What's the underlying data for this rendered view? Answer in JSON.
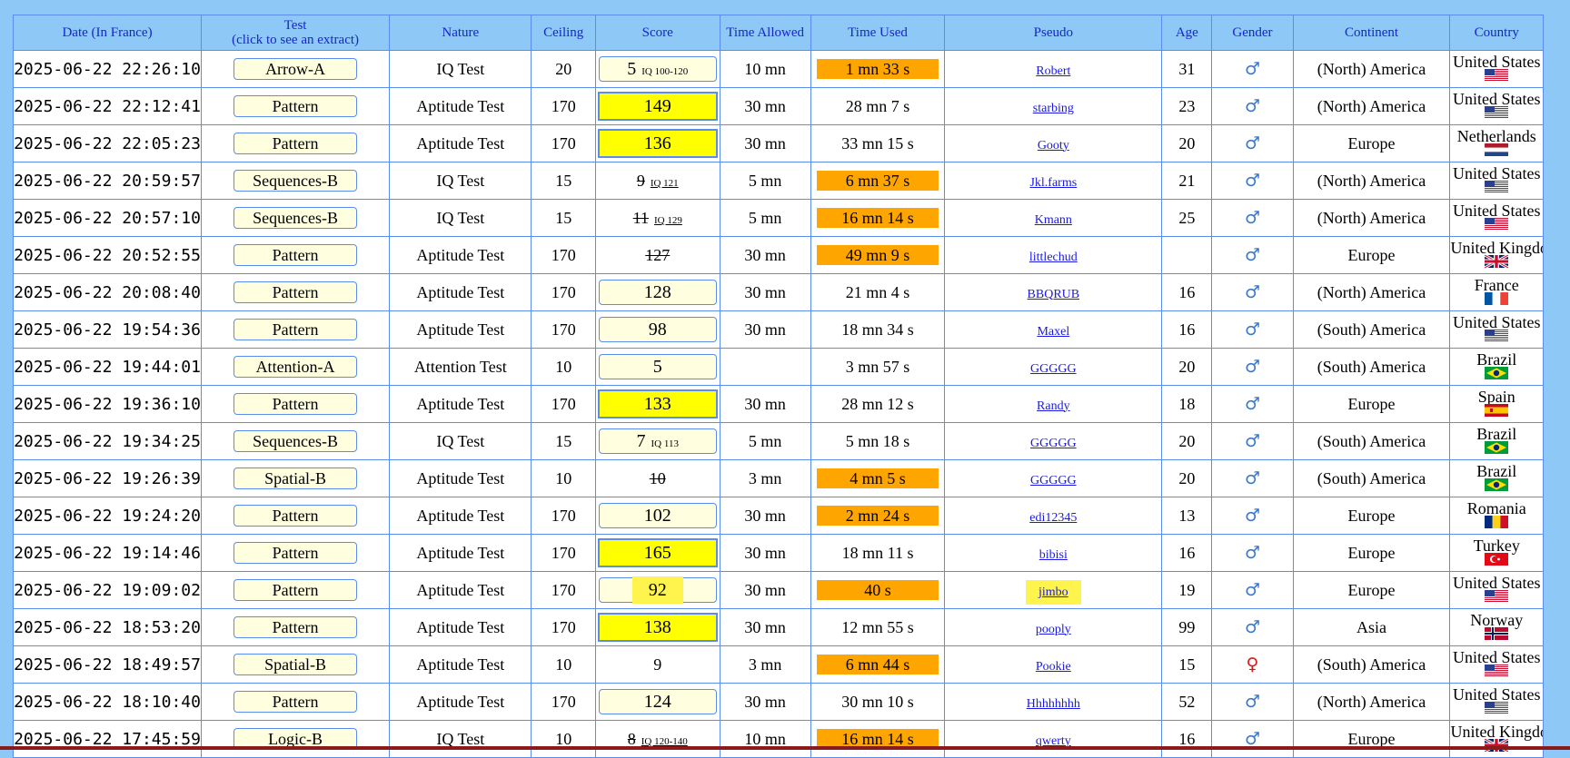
{
  "headers": {
    "date": "Date (In France)",
    "test": "Test",
    "test_sub": "(click to see an extract)",
    "nature": "Nature",
    "ceiling": "Ceiling",
    "score": "Score",
    "time_allowed": "Time Allowed",
    "time_used": "Time Used",
    "pseudo": "Pseudo",
    "age": "Age",
    "gender": "Gender",
    "continent": "Continent",
    "country": "Country"
  },
  "gender_symbols": {
    "male": "♂",
    "female": "♀"
  },
  "colors": {
    "header_bg": "#8ec8f6",
    "header_text": "#1626c9",
    "border": "#5b8def",
    "score_high": "#ffff00",
    "time_over": "#ffa500",
    "link": "#1a1ae6"
  },
  "rows": [
    {
      "date": "2025-06-22 22:26:10",
      "test": "Arrow-A",
      "nature": "IQ Test",
      "ceiling": "20",
      "score": "5",
      "iq": "IQ 100-120",
      "style": "box",
      "time_allowed": "10 mn",
      "time_used": "1 mn 33 s",
      "over": true,
      "pseudo": "Robert",
      "age": "31",
      "gender": "male",
      "continent": "(North) America",
      "country": "United States",
      "flag": "us"
    },
    {
      "date": "2025-06-22 22:12:41",
      "test": "Pattern",
      "nature": "Aptitude Test",
      "ceiling": "170",
      "score": "149",
      "iq": "",
      "style": "high",
      "time_allowed": "30 mn",
      "time_used": "28 mn 7 s",
      "over": false,
      "pseudo": "starbing",
      "age": "23",
      "gender": "male",
      "continent": "(North) America",
      "country": "United States",
      "flag": "us"
    },
    {
      "date": "2025-06-22 22:05:23",
      "test": "Pattern",
      "nature": "Aptitude Test",
      "ceiling": "170",
      "score": "136",
      "iq": "",
      "style": "high",
      "time_allowed": "30 mn",
      "time_used": "33 mn 15 s",
      "over": false,
      "pseudo": "Gooty",
      "age": "20",
      "gender": "male",
      "continent": "Europe",
      "country": "Netherlands",
      "flag": "nl"
    },
    {
      "date": "2025-06-22 20:59:57",
      "test": "Sequences-B",
      "nature": "IQ Test",
      "ceiling": "15",
      "score": "9",
      "iq": "IQ 121",
      "style": "struck",
      "time_allowed": "5 mn",
      "time_used": "6 mn 37 s",
      "over": true,
      "pseudo": "Jkl.farms",
      "age": "21",
      "gender": "male",
      "continent": "(North) America",
      "country": "United States",
      "flag": "us"
    },
    {
      "date": "2025-06-22 20:57:10",
      "test": "Sequences-B",
      "nature": "IQ Test",
      "ceiling": "15",
      "score": "11",
      "iq": "IQ 129",
      "style": "struck",
      "time_allowed": "5 mn",
      "time_used": "16 mn 14 s",
      "over": true,
      "pseudo": "Kmann",
      "age": "25",
      "gender": "male",
      "continent": "(North) America",
      "country": "United States",
      "flag": "us"
    },
    {
      "date": "2025-06-22 20:52:55",
      "test": "Pattern",
      "nature": "Aptitude Test",
      "ceiling": "170",
      "score": "127",
      "iq": "",
      "style": "struck",
      "time_allowed": "30 mn",
      "time_used": "49 mn 9 s",
      "over": true,
      "pseudo": "littlechud",
      "age": "",
      "gender": "male",
      "continent": "Europe",
      "country": "United Kingdom",
      "flag": "gb"
    },
    {
      "date": "2025-06-22 20:08:40",
      "test": "Pattern",
      "nature": "Aptitude Test",
      "ceiling": "170",
      "score": "128",
      "iq": "",
      "style": "box",
      "time_allowed": "30 mn",
      "time_used": "21 mn 4 s",
      "over": false,
      "pseudo": "BBQRUB",
      "age": "16",
      "gender": "male",
      "continent": "(North) America",
      "country": "France",
      "flag": "fr"
    },
    {
      "date": "2025-06-22 19:54:36",
      "test": "Pattern",
      "nature": "Aptitude Test",
      "ceiling": "170",
      "score": "98",
      "iq": "",
      "style": "box",
      "time_allowed": "30 mn",
      "time_used": "18 mn 34 s",
      "over": false,
      "pseudo": "Maxel",
      "age": "16",
      "gender": "male",
      "continent": "(South) America",
      "country": "United States",
      "flag": "us"
    },
    {
      "date": "2025-06-22 19:44:01",
      "test": "Attention-A",
      "nature": "Attention Test",
      "ceiling": "10",
      "score": "5",
      "iq": "",
      "style": "box",
      "time_allowed": "",
      "time_used": "3 mn 57 s",
      "over": false,
      "pseudo": "GGGGG",
      "age": "20",
      "gender": "male",
      "continent": "(South) America",
      "country": "Brazil",
      "flag": "br"
    },
    {
      "date": "2025-06-22 19:36:10",
      "test": "Pattern",
      "nature": "Aptitude Test",
      "ceiling": "170",
      "score": "133",
      "iq": "",
      "style": "high",
      "time_allowed": "30 mn",
      "time_used": "28 mn 12 s",
      "over": false,
      "pseudo": "Randy",
      "age": "18",
      "gender": "male",
      "continent": "Europe",
      "country": "Spain",
      "flag": "es"
    },
    {
      "date": "2025-06-22 19:34:25",
      "test": "Sequences-B",
      "nature": "IQ Test",
      "ceiling": "15",
      "score": "7",
      "iq": "IQ 113",
      "style": "box",
      "time_allowed": "5 mn",
      "time_used": "5 mn 18 s",
      "over": false,
      "pseudo": "GGGGG",
      "age": "20",
      "gender": "male",
      "continent": "(South) America",
      "country": "Brazil",
      "flag": "br"
    },
    {
      "date": "2025-06-22 19:26:39",
      "test": "Spatial-B",
      "nature": "Aptitude Test",
      "ceiling": "10",
      "score": "10",
      "iq": "",
      "style": "struck",
      "time_allowed": "3 mn",
      "time_used": "4 mn 5 s",
      "over": true,
      "pseudo": "GGGGG",
      "age": "20",
      "gender": "male",
      "continent": "(South) America",
      "country": "Brazil",
      "flag": "br"
    },
    {
      "date": "2025-06-22 19:24:20",
      "test": "Pattern",
      "nature": "Aptitude Test",
      "ceiling": "170",
      "score": "102",
      "iq": "",
      "style": "box",
      "time_allowed": "30 mn",
      "time_used": "2 mn 24 s",
      "over": true,
      "pseudo": "edi12345",
      "age": "13",
      "gender": "male",
      "continent": "Europe",
      "country": "Romania",
      "flag": "ro"
    },
    {
      "date": "2025-06-22 19:14:46",
      "test": "Pattern",
      "nature": "Aptitude Test",
      "ceiling": "170",
      "score": "165",
      "iq": "",
      "style": "high",
      "time_allowed": "30 mn",
      "time_used": "18 mn 11 s",
      "over": false,
      "pseudo": "bibisi",
      "age": "16",
      "gender": "male",
      "continent": "Europe",
      "country": "Turkey",
      "flag": "tr"
    },
    {
      "date": "2025-06-22 19:09:02",
      "test": "Pattern",
      "nature": "Aptitude Test",
      "ceiling": "170",
      "score": "92",
      "iq": "",
      "style": "box-hl",
      "time_allowed": "30 mn",
      "time_used": "40 s",
      "over": true,
      "pseudo": "jimbo",
      "pseudo_hl": true,
      "age": "19",
      "gender": "male",
      "continent": "Europe",
      "country": "United States",
      "flag": "us"
    },
    {
      "date": "2025-06-22 18:53:20",
      "test": "Pattern",
      "nature": "Aptitude Test",
      "ceiling": "170",
      "score": "138",
      "iq": "",
      "style": "high",
      "time_allowed": "30 mn",
      "time_used": "12 mn 55 s",
      "over": false,
      "pseudo": "pooply",
      "age": "99",
      "gender": "male",
      "continent": "Asia",
      "country": "Norway",
      "flag": "no"
    },
    {
      "date": "2025-06-22 18:49:57",
      "test": "Spatial-B",
      "nature": "Aptitude Test",
      "ceiling": "10",
      "score": "9",
      "iq": "",
      "style": "plain",
      "time_allowed": "3 mn",
      "time_used": "6 mn 44 s",
      "over": true,
      "pseudo": "Pookie",
      "age": "15",
      "gender": "female",
      "continent": "(South) America",
      "country": "United States",
      "flag": "us"
    },
    {
      "date": "2025-06-22 18:10:40",
      "test": "Pattern",
      "nature": "Aptitude Test",
      "ceiling": "170",
      "score": "124",
      "iq": "",
      "style": "box",
      "time_allowed": "30 mn",
      "time_used": "30 mn 10 s",
      "over": false,
      "pseudo": "Hhhhhhhh",
      "age": "52",
      "gender": "male",
      "continent": "(North) America",
      "country": "United States",
      "flag": "us"
    },
    {
      "date": "2025-06-22 17:45:59",
      "test": "Logic-B",
      "nature": "IQ Test",
      "ceiling": "10",
      "score": "8",
      "iq": "IQ 120-140",
      "style": "struck",
      "time_allowed": "10 mn",
      "time_used": "16 mn 14 s",
      "over": true,
      "pseudo": "qwerty",
      "age": "16",
      "gender": "male",
      "continent": "Europe",
      "country": "United Kingdom",
      "flag": "gb"
    }
  ]
}
